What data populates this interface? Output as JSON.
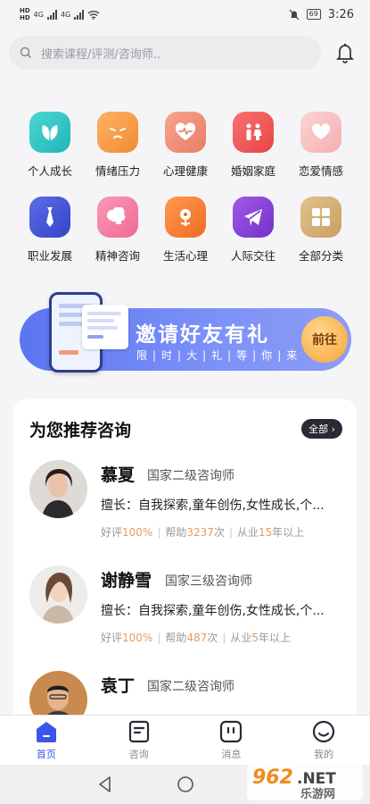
{
  "status_bar": {
    "left_tag_top": "HD",
    "left_tag_bottom": "HD",
    "net1": "4G",
    "net2": "4G",
    "battery": "69",
    "time": "3:26"
  },
  "search": {
    "placeholder": "搜索课程/评测/咨询师.."
  },
  "categories": [
    {
      "label": "个人成长",
      "icon": "leaf-icon",
      "color": "#2fc6c4"
    },
    {
      "label": "情绪压力",
      "icon": "angry-face-icon",
      "color": "#f6a04d"
    },
    {
      "label": "心理健康",
      "icon": "heart-pulse-icon",
      "color": "#f08d75"
    },
    {
      "label": "婚姻家庭",
      "icon": "couple-icon",
      "color": "#ee5a5a"
    },
    {
      "label": "恋爱情感",
      "icon": "heart-icon",
      "color": "#f7b1b5"
    },
    {
      "label": "职业发展",
      "icon": "tie-icon",
      "color": "#3f51d8"
    },
    {
      "label": "精神咨询",
      "icon": "brain-icon",
      "color": "#f47ea2"
    },
    {
      "label": "生活心理",
      "icon": "flower-icon",
      "color": "#f57c38"
    },
    {
      "label": "人际交往",
      "icon": "paper-plane-icon",
      "color": "#8640d6"
    },
    {
      "label": "全部分类",
      "icon": "grid-icon",
      "color": "#d7b27b"
    }
  ],
  "banner": {
    "title": "邀请好友有礼",
    "subtitle": "限|时|大|礼|等|你|来",
    "button": "前往"
  },
  "recommend": {
    "title": "为您推荐咨询",
    "all_label": "全部",
    "counselors": [
      {
        "name": "慕夏",
        "level": "国家二级咨询师",
        "specialty": "擅长：自我探索,童年创伤,女性成长,个...",
        "rating_label": "好评",
        "rating": "100%",
        "help_label": "帮助",
        "help_count": "3237",
        "help_unit": "次",
        "exp_label": "从业",
        "exp_years": "15",
        "exp_unit": "年以上"
      },
      {
        "name": "谢静雪",
        "level": "国家三级咨询师",
        "specialty": "擅长：自我探索,童年创伤,女性成长,个...",
        "rating_label": "好评",
        "rating": "100%",
        "help_label": "帮助",
        "help_count": "487",
        "help_unit": "次",
        "exp_label": "从业",
        "exp_years": "5",
        "exp_unit": "年以上"
      },
      {
        "name": "袁丁",
        "level": "国家二级咨询师",
        "specialty": "",
        "rating_label": "",
        "rating": "",
        "help_label": "",
        "help_count": "",
        "help_unit": "",
        "exp_label": "",
        "exp_years": "",
        "exp_unit": ""
      }
    ]
  },
  "tabbar": {
    "home": "首页",
    "consult": "咨询",
    "message": "消息",
    "mine": "我的"
  },
  "watermark": {
    "text1": "962",
    "text2": ".NET",
    "text3": "乐游网"
  }
}
